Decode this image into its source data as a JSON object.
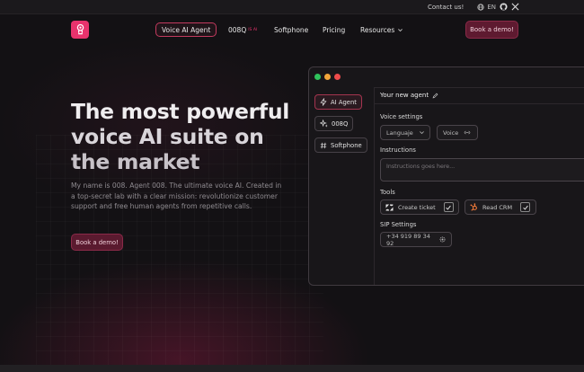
{
  "topbar": {
    "contact": "Contact us!",
    "language": "EN",
    "icons": [
      "globe-icon",
      "chevron-down-icon",
      "github-icon",
      "x-icon"
    ]
  },
  "nav": {
    "items": [
      {
        "label": "Voice AI Agent",
        "active": true
      },
      {
        "label": "008Q",
        "badge": "IS AI"
      },
      {
        "label": "Softphone"
      },
      {
        "label": "Pricing"
      },
      {
        "label": "Resources"
      }
    ],
    "cta": "Book a demo!"
  },
  "hero": {
    "title_lines": [
      "The most powerful",
      "voice AI suite on",
      "the market"
    ],
    "subtitle": "My name is 008. Agent 008. The ultimate voice AI. Created in a top-secret lab with a clear mission: revolutionize customer support and free human agents from repetitive calls.",
    "cta": "Book a demo!"
  },
  "app": {
    "sidebar": [
      {
        "label": "AI Agent",
        "icon": "lightning-icon",
        "active": true
      },
      {
        "label": "008Q",
        "icon": "sparkle-icon"
      },
      {
        "label": "Softphone",
        "icon": "hash-icon"
      }
    ],
    "agent_title": "Your new agent",
    "voice_settings": {
      "label": "Voice settings",
      "language": "Languaje",
      "voice": "Voice"
    },
    "instructions": {
      "label": "Instructions",
      "placeholder": "Instructions goes here..."
    },
    "tools": {
      "label": "Tools",
      "items": [
        {
          "label": "Create ticket",
          "icon": "zendesk-icon",
          "checked": true
        },
        {
          "label": "Read CRM",
          "icon": "hubspot-icon",
          "checked": true
        }
      ]
    },
    "sip": {
      "label": "SIP Settings",
      "number": "+34 919 89 34 92"
    }
  },
  "colors": {
    "accent": "#e8336d",
    "accent_dark": "#5e1a30",
    "background": "#131114",
    "dot_green": "#2fc25b",
    "dot_yellow": "#f2a53a",
    "dot_red": "#ee4b4b"
  }
}
